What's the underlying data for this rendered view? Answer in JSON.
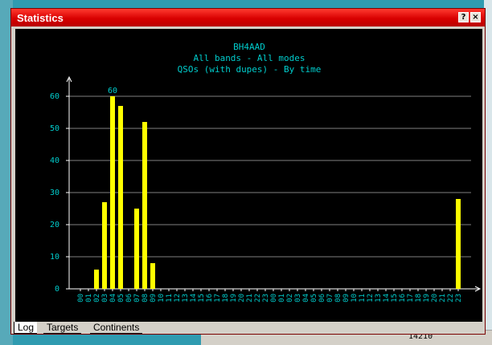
{
  "window": {
    "title": "Statistics",
    "help_glyph": "?",
    "close_glyph": "×"
  },
  "tabs": [
    "Log",
    "Targets",
    "Continents"
  ],
  "background": {
    "frequency_text": "14210"
  },
  "colors": {
    "titlebar": "#d80000",
    "plot_background": "#000000",
    "bar": "#ffff00",
    "text": "#00cccc",
    "grid": "#808080"
  },
  "chart_data": {
    "type": "bar",
    "title": "BH4AAD",
    "subtitle_lines": [
      "All bands - All modes",
      "QSOs (with dupes) - By time"
    ],
    "xlabel": "",
    "ylabel": "",
    "ylim": [
      0,
      60
    ],
    "yticks": [
      0,
      10,
      20,
      30,
      40,
      50,
      60
    ],
    "grid": true,
    "categories": [
      "00",
      "01",
      "02",
      "03",
      "04",
      "05",
      "06",
      "07",
      "08",
      "09",
      "10",
      "11",
      "12",
      "13",
      "14",
      "15",
      "16",
      "17",
      "18",
      "19",
      "20",
      "21",
      "22",
      "23",
      "00",
      "01",
      "02",
      "03",
      "04",
      "05",
      "06",
      "07",
      "08",
      "09",
      "10",
      "11",
      "12",
      "13",
      "14",
      "15",
      "16",
      "17",
      "18",
      "19",
      "20",
      "21",
      "22",
      "23"
    ],
    "values": [
      0,
      0,
      6,
      27,
      60,
      57,
      0,
      25,
      52,
      8,
      0,
      0,
      0,
      0,
      0,
      0,
      0,
      0,
      0,
      0,
      0,
      0,
      0,
      0,
      0,
      0,
      0,
      0,
      0,
      0,
      0,
      0,
      0,
      0,
      0,
      0,
      0,
      0,
      0,
      0,
      0,
      0,
      0,
      0,
      0,
      0,
      0,
      28
    ],
    "peak_label": "60",
    "peak_index": 4
  }
}
